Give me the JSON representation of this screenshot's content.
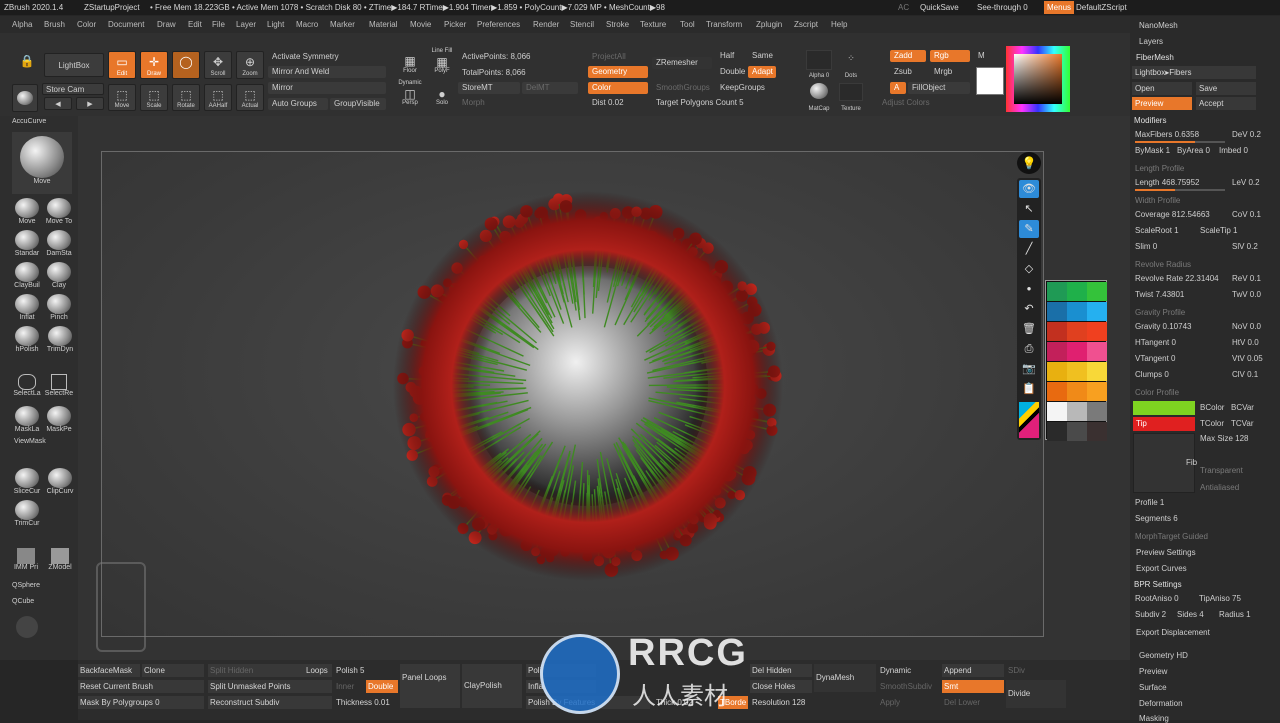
{
  "title_bar": {
    "app": "ZBrush 2020.1.4",
    "project": "ZStartupProject",
    "stats": "• Free Mem 18.223GB • Active Mem 1078 • Scratch Disk 80 • ZTime▶184.7 RTime▶1.904 Timer▶1.859 • PolyCount▶7.029 MP • MeshCount▶98",
    "ac": "AC",
    "quicksave": "QuickSave",
    "seethrough": "See-through  0",
    "menus": "Menus",
    "script": "DefaultZScript"
  },
  "menu": [
    "Alpha",
    "Brush",
    "Color",
    "Document",
    "Draw",
    "Edit",
    "File",
    "Layer",
    "Light",
    "Macro",
    "Marker",
    "Material",
    "Movie",
    "Picker",
    "Preferences",
    "Render",
    "Stencil",
    "Stroke",
    "Texture",
    "Tool",
    "Transform",
    "Zplugin",
    "Zscript",
    "Help"
  ],
  "toolbar": {
    "lightbox": "LightBox",
    "storecam": "Store Cam",
    "edit": "Edit",
    "draw": "Draw",
    "scroll": "Scroll",
    "zoom": "Zoom",
    "move": "Move",
    "scale": "Scale",
    "rotate": "Rotate",
    "aahalf": "AAHalf",
    "actual": "Actual",
    "activate_symmetry": "Activate Symmetry",
    "mirror_weld": "Mirror And Weld",
    "mirror": "Mirror",
    "auto_groups": "Auto Groups",
    "group_visible": "GroupVisible",
    "floor": "Floor",
    "line_fill": "Line Fill",
    "polyf": "PolyF",
    "persp": "Persp",
    "dynamic": "Dynamic",
    "solo": "Solo",
    "active_points": "ActivePoints: 8,066",
    "total_points": "TotalPoints: 8,066",
    "storemt": "StoreMT",
    "delmt": "DelMT",
    "morph": "Morph",
    "project_all": "ProjectAll",
    "geometry": "Geometry",
    "color": "Color",
    "dist": "Dist 0.02",
    "zremesher": "ZRemesher",
    "smoothgroups": "SmoothGroups",
    "target_polys": "Target Polygons Count 5",
    "half": "Half",
    "same": "Same",
    "double": "Double",
    "adapt": "Adapt",
    "keepgroups": "KeepGroups",
    "alpha": "Alpha 0",
    "dots": "Dots",
    "matcap": "MatCap",
    "texture": "Texture",
    "zadd": "Zadd",
    "zsub": "Zsub",
    "rgb": "Rgb",
    "mrgb": "Mrgb",
    "m": "M",
    "a": "A",
    "fillobject": "FillObject",
    "adjust_colors": "Adjust Colors"
  },
  "left_shelf": {
    "accucurve": "AccuCurve",
    "main_brush": "Move",
    "brushes": [
      "Move",
      "Move To",
      "Standar",
      "DamSta",
      "ClayBuil",
      "Clay",
      "Inflat",
      "Pinch",
      "hPolish",
      "TrimDyn"
    ],
    "selectlasso": "SelectLa",
    "selectrect": "SelectRe",
    "masklasso": "MaskLa",
    "maskpen": "MaskPe",
    "viewmask": "ViewMask",
    "slicecurve": "SliceCur",
    "clipcurve": "ClipCurv",
    "trimcurve": "TrimCur",
    "imm": "IMM Pri",
    "zmodeler": "ZModel",
    "qsphere": "QSphere",
    "qcube": "QCube"
  },
  "right_panel": {
    "nanomesh": "NanoMesh",
    "layers": "Layers",
    "fibermesh": "FiberMesh",
    "lightbox_fibers": "Lightbox▸Fibers",
    "open": "Open",
    "save": "Save",
    "preview": "Preview",
    "accept": "Accept",
    "modifiers": "Modifiers",
    "max_fibers": "MaxFibers 0.6358",
    "dev1": "DeV 0.2",
    "bymask": "ByMask 1",
    "byarea": "ByArea 0",
    "imbed": "Imbed 0",
    "length_profile": "Length Profile",
    "length": "Length 468.75952",
    "lev": "LeV 0.2",
    "width_profile": "Width Profile",
    "coverage": "Coverage 812.54663",
    "cov": "CoV 0.1",
    "scaleroot": "ScaleRoot 1",
    "scaletip": "ScaleTip 1",
    "slim": "Slim 0",
    "slv": "SlV 0.2",
    "revolve_radius": "Revolve Radius",
    "revolve_rate": "Revolve Rate 22.31404",
    "rev": "ReV 0.1",
    "twist": "Twist 7.43801",
    "twv": "TwV 0.0",
    "gravity_profile": "Gravity Profile",
    "gravity": "Gravity 0.10743",
    "nov": "NoV 0.0",
    "htangent": "HTangent 0",
    "htv": "HtV 0.0",
    "vtangent": "VTangent 0",
    "vtv": "VtV 0.05",
    "clumps": "Clumps 0",
    "clv": "ClV 0.1",
    "color_profile": "Color Profile",
    "bcolor": "BColor",
    "bcvar": "BCVar",
    "tip": "Tip",
    "tcolor": "TColor",
    "tcvar": "TCVar",
    "max_size": "Max Size 128",
    "fib": "Fib",
    "transparent": "Transparent",
    "antialiased": "Antialiased",
    "profile": "Profile 1",
    "segments": "Segments 6",
    "morphtarget": "MorphTarget Guided",
    "preview_settings": "Preview Settings",
    "export_curves": "Export Curves",
    "bpr_settings": "BPR Settings",
    "rootaniso": "RootAniso 0",
    "tipaniso": "TipAniso 75",
    "subdiv": "Subdiv 2",
    "sides": "Sides 4",
    "radius": "Radius 1",
    "export_displacement": "Export Displacement",
    "geometry_hd": "Geometry HD",
    "preview2": "Preview",
    "surface": "Surface",
    "deformation": "Deformation",
    "masking": "Masking",
    "bcolor_hex": "#7ed321",
    "tcolor_hex": "#e02020"
  },
  "bottom_bar": {
    "backface": "BackfaceMask",
    "clone": "Clone",
    "split_hidden": "Split Hidden",
    "loops": "Loops",
    "polish": "Polish 5",
    "reset_brush": "Reset Current Brush",
    "split_unmasked": "Split Unmasked Points",
    "inner": "Inner",
    "double": "Double",
    "panel_loops": "Panel Loops",
    "clay_polish": "ClayPolish",
    "mask_polygroups": "Mask By Polygroups 0",
    "reconstruct": "Reconstruct Subdiv",
    "thickness": "Thickness 0.01",
    "poli": "Poli",
    "infla": "Infla",
    "polish_features": "Polish By Features",
    "thick": "Thick 0.02",
    "del_hidden": "Del Hidden",
    "close_holes": "Close Holes",
    "tborder": "TBorde",
    "resolution": "Resolution 128",
    "dynamesh": "DynaMesh",
    "dynamic": "Dynamic",
    "smoothsubdiv": "SmoothSubdiv",
    "apply": "Apply",
    "append": "Append",
    "smt": "Smt",
    "del_lower": "Del Lower",
    "sdiv": "SDiv",
    "divide": "Divide"
  },
  "watermark": {
    "brand": "RRCG",
    "sub": "人人素材"
  },
  "palette_colors": [
    "#1f9a55",
    "#1fb04a",
    "#34c23a",
    "#1a6fa8",
    "#1a8fd0",
    "#25b0f0",
    "#c2301f",
    "#e0401f",
    "#f0401f",
    "#c2205a",
    "#e02070",
    "#f05090",
    "#e8b010",
    "#f0c020",
    "#f8d838",
    "#e86a10",
    "#f08a18",
    "#f8a020",
    "#f4f4f4",
    "#b8b8b8",
    "#7a7a7a",
    "#2a2a2a",
    "#4a4a4a",
    "#3a3030"
  ]
}
